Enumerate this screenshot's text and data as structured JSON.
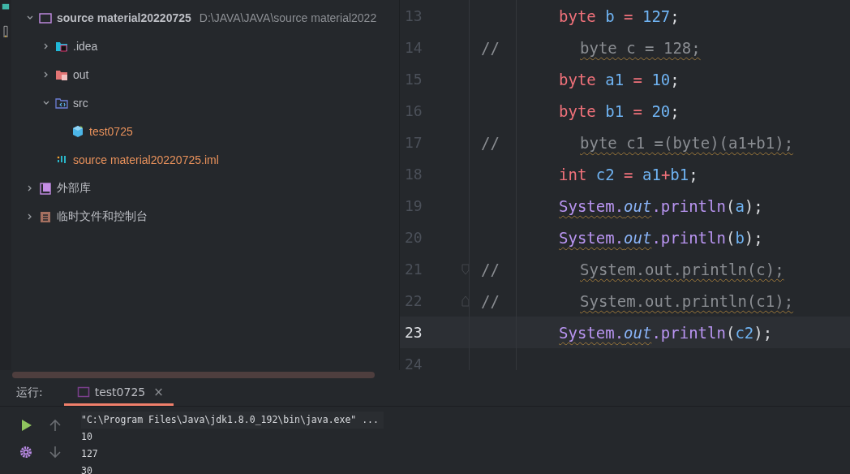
{
  "project_tree": {
    "items": [
      {
        "kind": "module",
        "label": "source material20220725",
        "path": "D:\\JAVA\\JAVA\\source material2022",
        "expanded": true,
        "children": [
          {
            "kind": "idea",
            "label": ".idea",
            "expanded": false
          },
          {
            "kind": "out",
            "label": "out",
            "expanded": false
          },
          {
            "kind": "src",
            "label": "src",
            "expanded": true,
            "children": [
              {
                "kind": "class",
                "label": "test0725"
              }
            ]
          },
          {
            "kind": "iml",
            "label": "source material20220725.iml"
          }
        ]
      },
      {
        "kind": "library",
        "label": "外部库",
        "expanded": false
      },
      {
        "kind": "scratch",
        "label": "临时文件和控制台",
        "expanded": false
      }
    ]
  },
  "editor": {
    "lines": [
      {
        "number": "13",
        "current": false,
        "tokens": [
          {
            "kind": "kw",
            "text": "byte"
          },
          {
            "kind": "var",
            "text": " b"
          },
          {
            "kind": "op",
            "text": " ="
          },
          {
            "kind": "num",
            "text": " 127"
          },
          {
            "kind": "plain",
            "text": ";"
          }
        ]
      },
      {
        "number": "14",
        "comment": "//",
        "current": false,
        "tokens": [
          {
            "kind": "commented",
            "text": "byte c = 128;"
          }
        ]
      },
      {
        "number": "15",
        "current": false,
        "tokens": [
          {
            "kind": "kw",
            "text": "byte"
          },
          {
            "kind": "var",
            "text": " a1"
          },
          {
            "kind": "op",
            "text": " ="
          },
          {
            "kind": "num",
            "text": " 10"
          },
          {
            "kind": "plain",
            "text": ";"
          }
        ]
      },
      {
        "number": "16",
        "current": false,
        "tokens": [
          {
            "kind": "kw",
            "text": "byte"
          },
          {
            "kind": "var",
            "text": " b1"
          },
          {
            "kind": "op",
            "text": " ="
          },
          {
            "kind": "num",
            "text": " 20"
          },
          {
            "kind": "plain",
            "text": ";"
          }
        ]
      },
      {
        "number": "17",
        "comment": "//",
        "current": false,
        "tokens": [
          {
            "kind": "commented",
            "text": "byte c1 =(byte)(a1+b1);"
          }
        ]
      },
      {
        "number": "18",
        "current": false,
        "tokens": [
          {
            "kind": "kw",
            "text": "int"
          },
          {
            "kind": "var",
            "text": " c2"
          },
          {
            "kind": "op",
            "text": " ="
          },
          {
            "kind": "var",
            "text": " a1"
          },
          {
            "kind": "op",
            "text": "+"
          },
          {
            "kind": "var",
            "text": "b1"
          },
          {
            "kind": "plain",
            "text": ";"
          }
        ]
      },
      {
        "number": "19",
        "current": false,
        "tokens": [
          {
            "kind": "cls",
            "text": "System."
          },
          {
            "kind": "field",
            "text": "out"
          },
          {
            "kind": "method",
            "text": ".println"
          },
          {
            "kind": "plain",
            "text": "("
          },
          {
            "kind": "var",
            "text": "a"
          },
          {
            "kind": "plain",
            "text": ");"
          }
        ]
      },
      {
        "number": "20",
        "current": false,
        "tokens": [
          {
            "kind": "cls",
            "text": "System."
          },
          {
            "kind": "field",
            "text": "out"
          },
          {
            "kind": "method",
            "text": ".println"
          },
          {
            "kind": "plain",
            "text": "("
          },
          {
            "kind": "var",
            "text": "b"
          },
          {
            "kind": "plain",
            "text": ");"
          }
        ]
      },
      {
        "number": "21",
        "comment": "//",
        "current": false,
        "kind": "fold-start",
        "tokens": [
          {
            "kind": "commented",
            "text": "System.out.println(c);"
          }
        ]
      },
      {
        "number": "22",
        "comment": "//",
        "current": false,
        "kind": "fold-end",
        "tokens": [
          {
            "kind": "commented",
            "text": "System.out.println(c1);"
          }
        ]
      },
      {
        "number": "23",
        "current": true,
        "tokens": [
          {
            "kind": "cls",
            "text": "System."
          },
          {
            "kind": "field",
            "text": "out"
          },
          {
            "kind": "method",
            "text": ".println"
          },
          {
            "kind": "plain",
            "text": "("
          },
          {
            "kind": "var",
            "text": "c2"
          },
          {
            "kind": "plain",
            "text": ");"
          }
        ]
      },
      {
        "number": "24",
        "current": false
      }
    ]
  },
  "run_panel": {
    "label": "运行:",
    "tabs": [
      {
        "label": "test0725",
        "selected": true,
        "close": "×"
      }
    ],
    "output": [
      "\"C:\\Program Files\\Java\\jdk1.8.0_192\\bin\\java.exe\" ...",
      "10",
      "127",
      "30"
    ]
  }
}
